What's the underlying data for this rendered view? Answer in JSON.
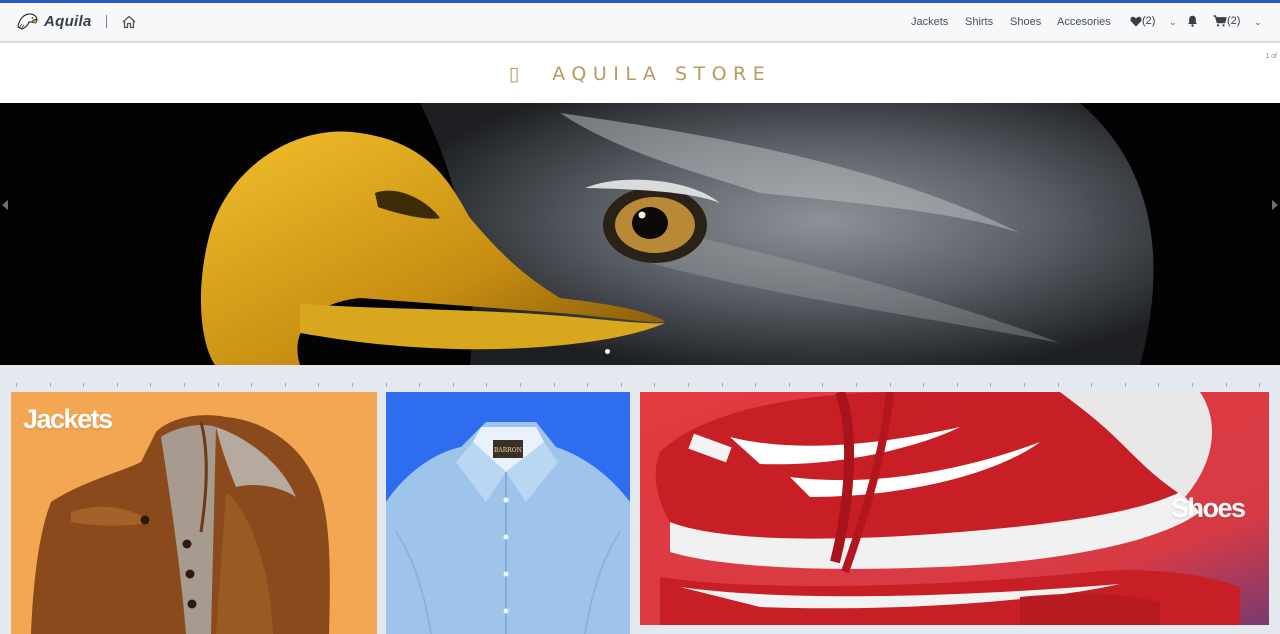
{
  "brand": {
    "name": "Aquila"
  },
  "nav": {
    "links": [
      "Jackets",
      "Shirts",
      "Shoes",
      "Accesories"
    ],
    "wishlist_count": "(2)",
    "cart_count": "(2)"
  },
  "store": {
    "title": "AQUILA STORE",
    "glyph": "▯",
    "slide_counter": "1 of"
  },
  "categories": [
    {
      "label": "Jackets",
      "image": "leather-jacket"
    },
    {
      "label": "",
      "image": "blue-shirt"
    },
    {
      "label": "Shoes",
      "image": "red-sneakers"
    }
  ],
  "icons": [
    "eagle-logo-icon",
    "home-icon",
    "heart-icon",
    "chevron-down-icon",
    "bell-icon",
    "cart-icon",
    "arrow-left-icon",
    "arrow-right-icon"
  ],
  "colors": {
    "accent": "#2f56c9",
    "store_title": "#b89a5a",
    "jackets_bg": "#f4a752",
    "shirts_bg": "#2e6cf0",
    "shoes_bg": "#d7343a"
  }
}
